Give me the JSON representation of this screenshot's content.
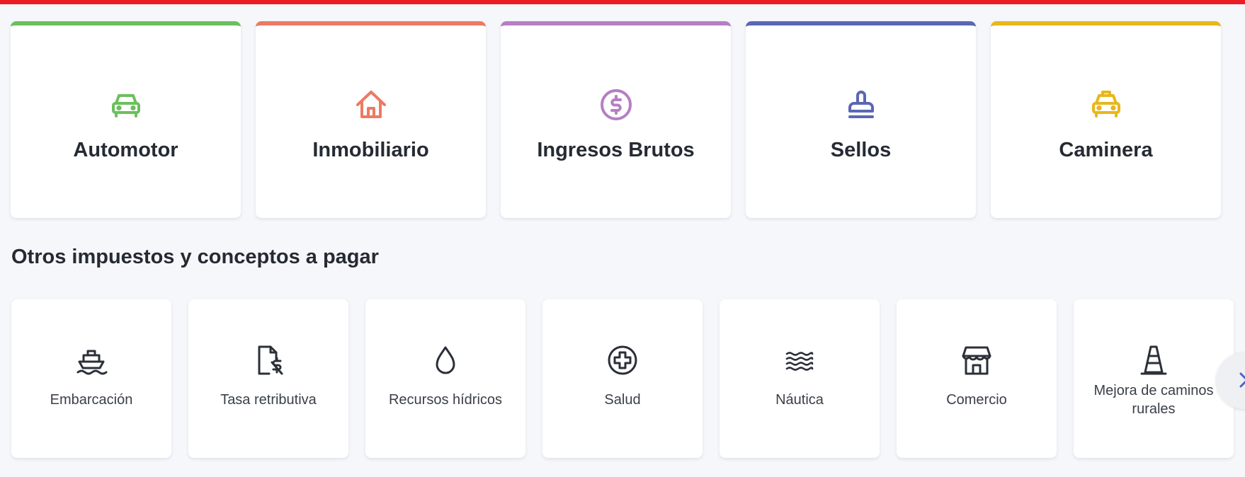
{
  "colors": {
    "top_line": "#ec1c24",
    "automotor": "#6cbf5e",
    "inmobiliario": "#ec7a63",
    "ingresos_brutos": "#b57fc3",
    "sellos": "#5b67b3",
    "caminera": "#e8b71c",
    "other_icons": "#2b2f38"
  },
  "main_cards": [
    {
      "label": "Automotor",
      "icon": "car-icon"
    },
    {
      "label": "Inmobiliario",
      "icon": "house-icon"
    },
    {
      "label": "Ingresos Brutos",
      "icon": "dollar-circle-icon"
    },
    {
      "label": "Sellos",
      "icon": "stamp-icon"
    },
    {
      "label": "Caminera",
      "icon": "taxi-icon"
    }
  ],
  "section": {
    "title": "Otros impuestos y conceptos a pagar"
  },
  "other_cards": [
    {
      "label": "Embarcación",
      "icon": "ship-icon"
    },
    {
      "label": "Tasa retributiva",
      "icon": "document-fee-icon"
    },
    {
      "label": "Recursos hídricos",
      "icon": "water-drop-icon"
    },
    {
      "label": "Salud",
      "icon": "health-cross-icon"
    },
    {
      "label": "Náutica",
      "icon": "waves-icon"
    },
    {
      "label": "Comercio",
      "icon": "store-icon"
    },
    {
      "label": "Mejora de caminos rurales",
      "icon": "traffic-cone-icon"
    }
  ],
  "carousel": {
    "next_icon": "chevron-right-icon"
  }
}
